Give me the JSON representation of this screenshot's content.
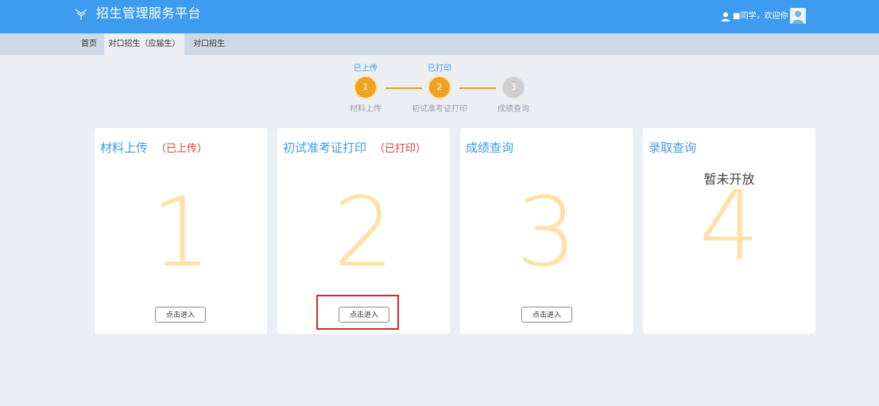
{
  "header": {
    "title": "招生管理服务平台",
    "user_text": "■同学，欢迎你"
  },
  "nav": {
    "items": [
      {
        "label": "首页"
      },
      {
        "label": "对口招生（应届生）"
      },
      {
        "label": "对口招生"
      }
    ]
  },
  "steps": [
    {
      "number": "1",
      "top_label": "已上传",
      "bottom_label": "材料上传",
      "state": "done"
    },
    {
      "number": "2",
      "top_label": "已打印",
      "bottom_label": "初试准考证打印",
      "state": "done"
    },
    {
      "number": "3",
      "top_label": "",
      "bottom_label": "成绩查询",
      "state": "todo"
    }
  ],
  "cards": [
    {
      "title": "材料上传",
      "status": "（已上传）",
      "number": "1",
      "button": "点击进入"
    },
    {
      "title": "初试准考证打印",
      "status": "（已打印）",
      "number": "2",
      "button": "点击进入"
    },
    {
      "title": "成绩查询",
      "status": "",
      "number": "3",
      "button": "点击进入"
    },
    {
      "title": "录取查询",
      "notice": "暂未开放",
      "number": "4"
    }
  ],
  "colors": {
    "primary": "#3d9bf0",
    "accent": "#f0a11e",
    "status_red": "#e53a3a",
    "number_color": "#fde1a6",
    "highlight": "#d6262c"
  },
  "icons": {
    "logo": "logo-icon",
    "user": "user-icon",
    "avatar": "avatar-icon"
  }
}
